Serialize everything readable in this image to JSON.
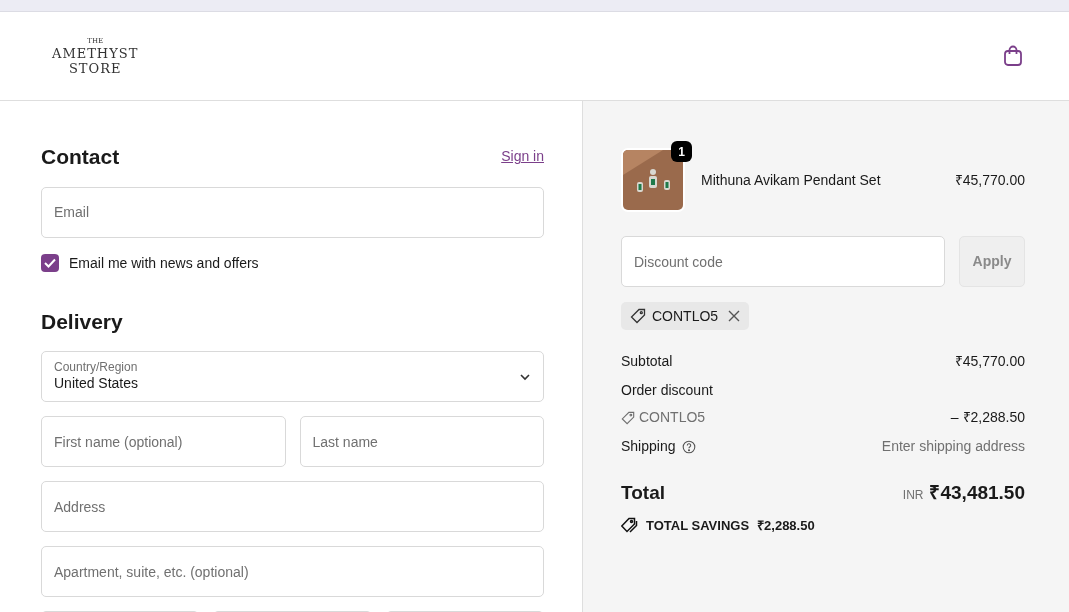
{
  "logo": {
    "small": "THE",
    "line1": "AMETHYST",
    "line2": "STORE"
  },
  "contact": {
    "heading": "Contact",
    "sign_in": "Sign in",
    "email": {
      "placeholder": "Email"
    },
    "news": {
      "label": "Email me with news and offers",
      "checked": true
    }
  },
  "delivery": {
    "heading": "Delivery",
    "country": {
      "label": "Country/Region",
      "value": "United States"
    },
    "fields": [
      {
        "placeholder": "First name (optional)",
        "kind": "half"
      },
      {
        "placeholder": "Last name",
        "kind": "half"
      },
      {
        "placeholder": "Address",
        "kind": "full"
      },
      {
        "placeholder": "Apartment, suite, etc. (optional)",
        "kind": "full"
      }
    ]
  },
  "order": {
    "item": {
      "name": "Mithuna Avikam Pendant Set",
      "price": "₹45,770.00",
      "quantity": "1",
      "kind": "picture"
    },
    "discount": {
      "placeholder": "Discount code",
      "button": "Apply"
    },
    "applied_code": "CONTLO5",
    "subtotal": {
      "label": "Subtotal",
      "value": "₹45,770.00"
    },
    "order_discount": {
      "label": "Order discount",
      "code": "CONTLO5",
      "value": "– ₹2,288.50"
    },
    "shipping": {
      "label": "Shipping",
      "value": "Enter shipping address"
    },
    "total": {
      "label": "Total",
      "currency": "INR",
      "value": "₹43,481.50"
    },
    "savings": {
      "label": "TOTAL SAVINGS",
      "value": "₹2,288.50"
    }
  }
}
